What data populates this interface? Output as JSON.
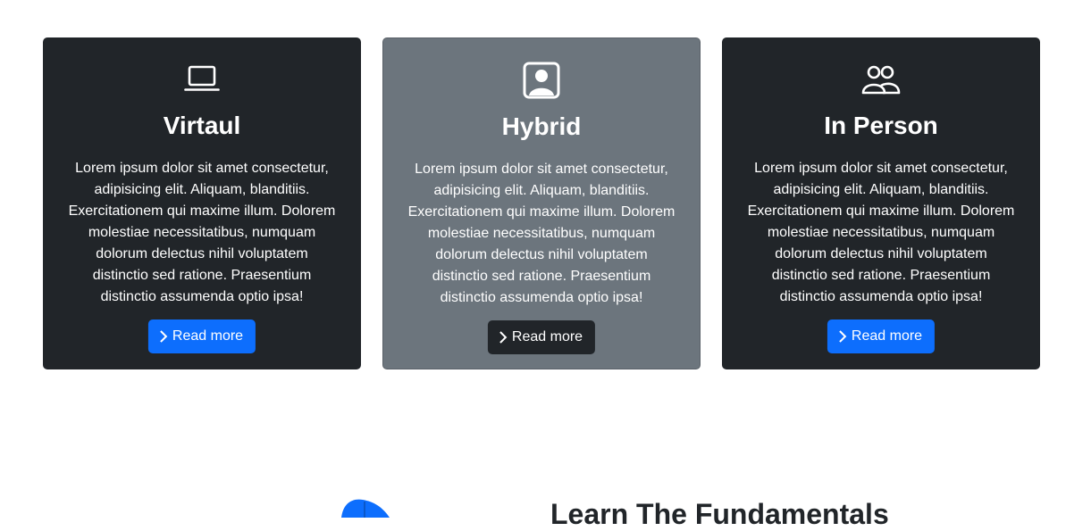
{
  "cards": [
    {
      "title": "Virtaul",
      "text": "Lorem ipsum dolor sit amet consectetur, adipisicing elit. Aliquam, blanditiis. Exercitationem qui maxime illum. Dolorem molestiae necessitatibus, numquam dolorum delectus nihil voluptatem distinctio sed ratione. Praesentium distinctio assumenda optio ipsa!",
      "button_label": "Read more",
      "icon": "laptop-icon"
    },
    {
      "title": "Hybrid",
      "text": "Lorem ipsum dolor sit amet consectetur, adipisicing elit. Aliquam, blanditiis. Exercitationem qui maxime illum. Dolorem molestiae necessitatibus, numquam dolorum delectus nihil voluptatem distinctio sed ratione. Praesentium distinctio assumenda optio ipsa!",
      "button_label": "Read more",
      "icon": "person-square-icon"
    },
    {
      "title": "In Person",
      "text": "Lorem ipsum dolor sit amet consectetur, adipisicing elit. Aliquam, blanditiis. Exercitationem qui maxime illum. Dolorem molestiae necessitatibus, numquam dolorum delectus nihil voluptatem distinctio sed ratione. Praesentium distinctio assumenda optio ipsa!",
      "button_label": "Read more",
      "icon": "people-icon"
    }
  ],
  "learn": {
    "title": "Learn The Fundamentals"
  },
  "colors": {
    "card_dark": "#212529",
    "card_gray": "#6c757d",
    "primary": "#0d6efd"
  }
}
